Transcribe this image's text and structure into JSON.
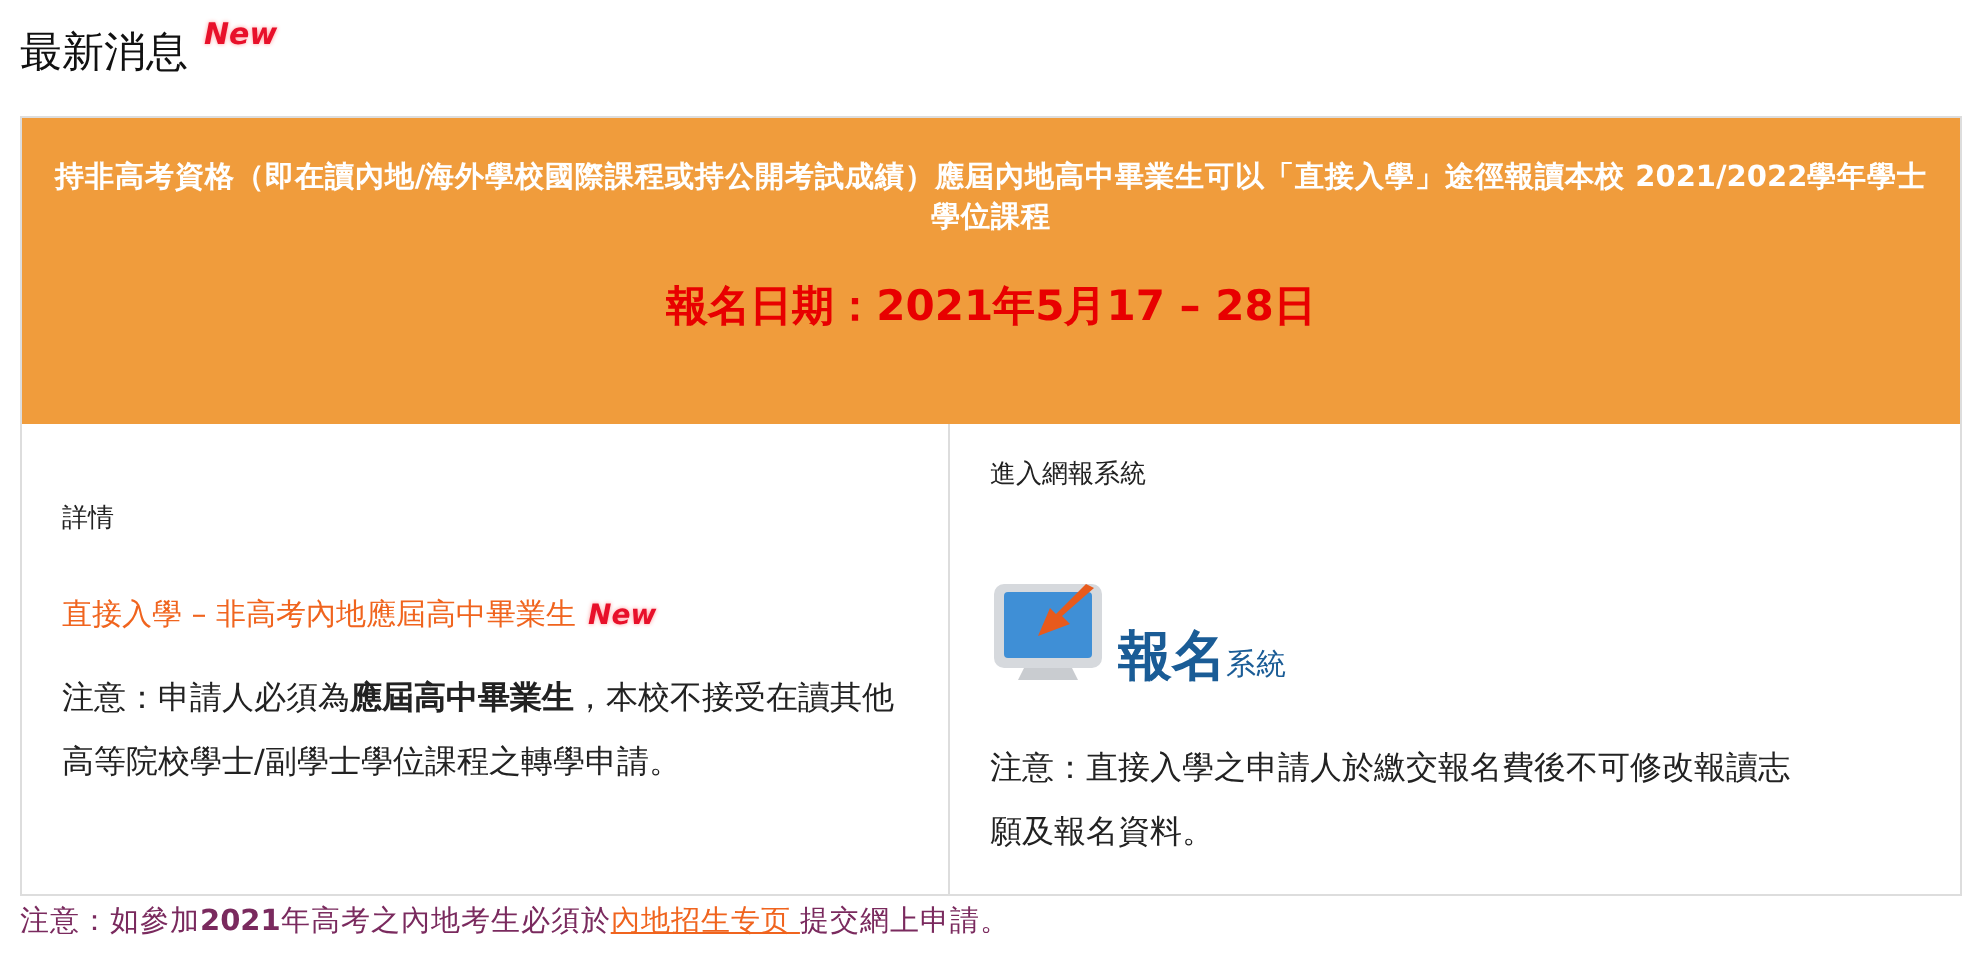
{
  "heading": {
    "title": "最新消息",
    "badge": "New"
  },
  "banner": {
    "text": "持非高考資格（即在讀內地/海外學校國際課程或持公開考試成績）應屆內地高中畢業生可以「直接入學」途徑報讀本校 2021/2022學年學士學位課程",
    "date": "報名日期：2021年5月17 – 28日"
  },
  "left": {
    "label": "詳情",
    "link": "直接入學 – 非高考內地應屆高中畢業生",
    "badge": "New",
    "note": "注意：申請人必須為**應屆高中畢業生**，本校不接受在讀其他高等院校學士/副學士學位課程之轉學申請。"
  },
  "right": {
    "label": "進入網報系統",
    "logo_main": "報名",
    "logo_sub": "系統",
    "note": "注意：直接入學之申請人於繳交報名費後不可修改報讀志願及報名資料。"
  },
  "footer": {
    "before": "注意：如參加**2021**年高考之內地考生必須於",
    "link": "內地招生专页 ",
    "after": " 提交網上申請。"
  }
}
